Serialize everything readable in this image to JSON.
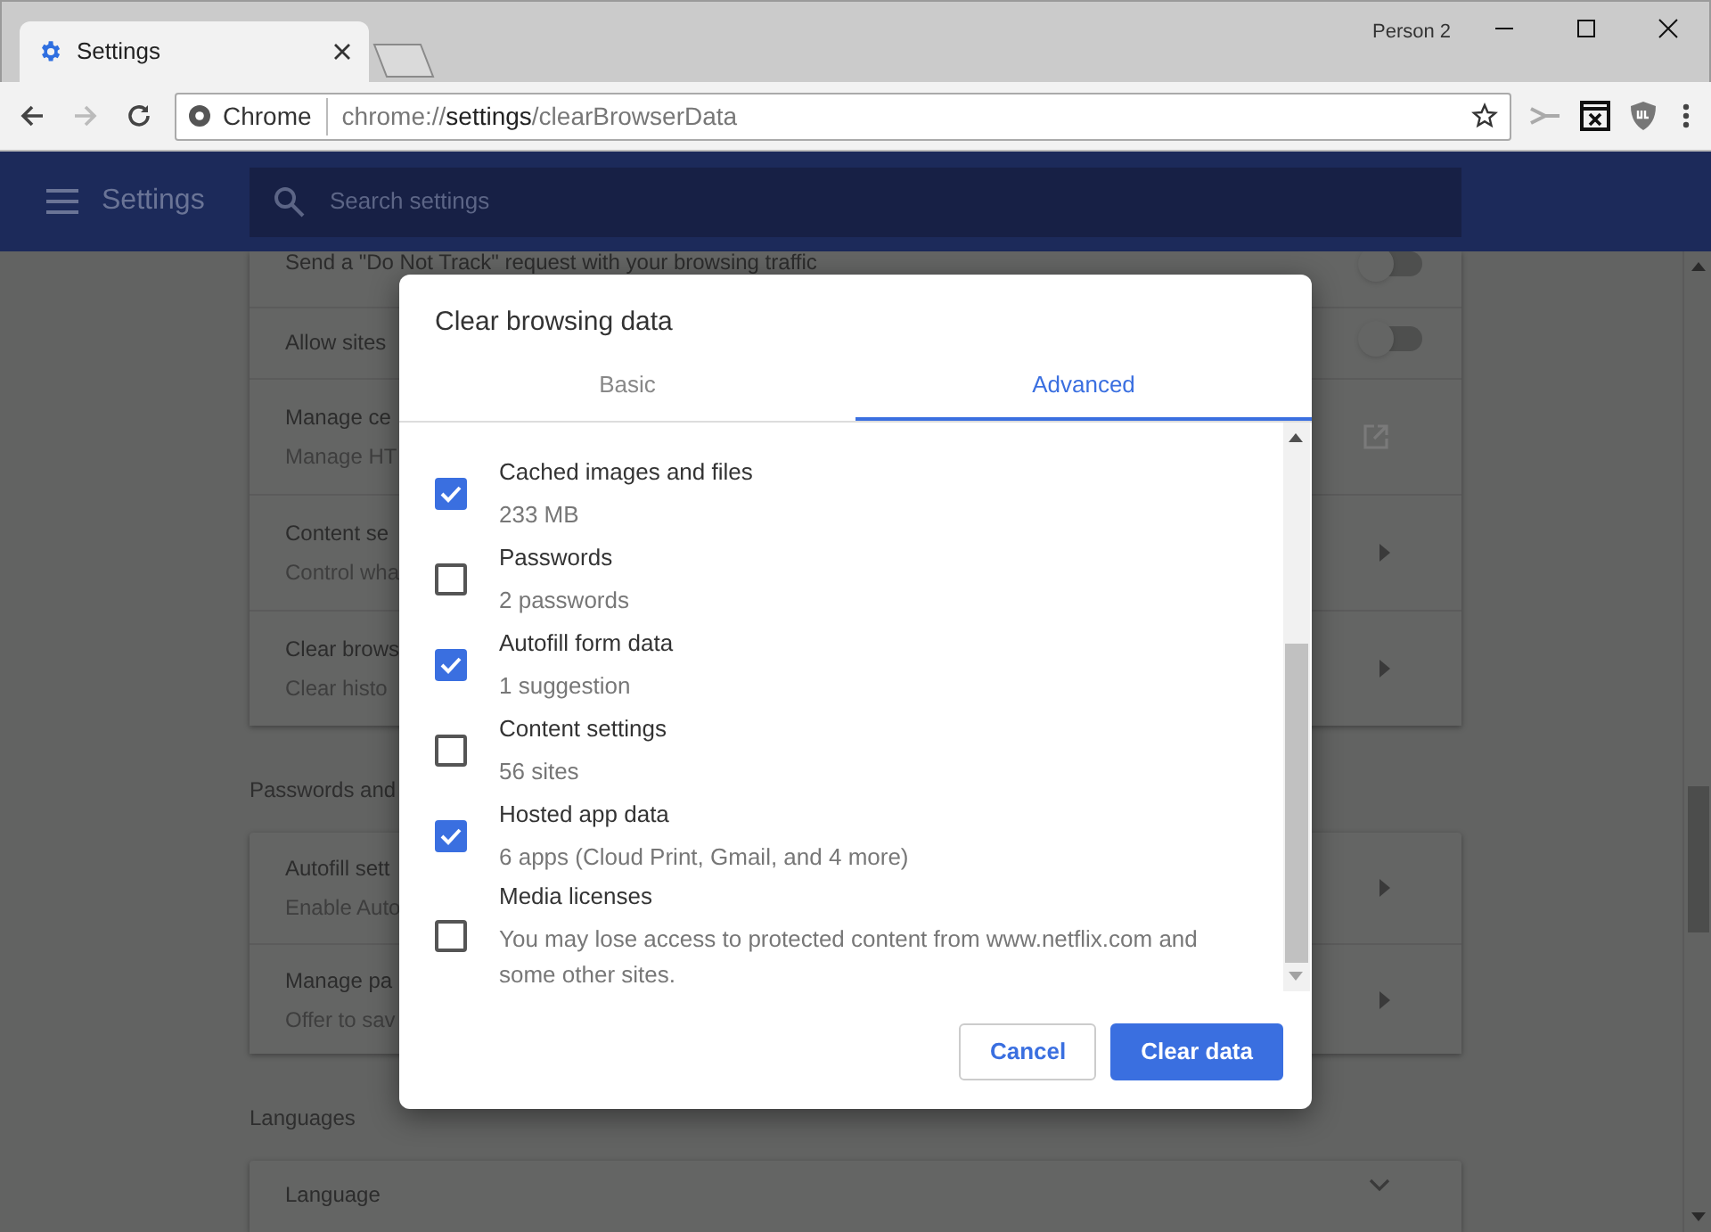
{
  "browser": {
    "tab": {
      "title": "Settings"
    },
    "profile": "Person 2",
    "omnibox": {
      "chip": "Chrome",
      "url_scheme": "chrome://",
      "url_host": "settings",
      "url_path": "/clearBrowserData"
    }
  },
  "header": {
    "title": "Settings",
    "search": {
      "placeholder": "Search settings"
    }
  },
  "sections": [
    {
      "rows": [
        {
          "title": "Send a \"Do Not Track\" request with your browsing traffic",
          "kind": "toggle",
          "on": false
        },
        {
          "title": "Allow sites",
          "kind": "toggle",
          "on": false
        },
        {
          "title": "Manage ce",
          "subtitle": "Manage HT",
          "kind": "external"
        },
        {
          "title": "Content se",
          "subtitle": "Control wha",
          "kind": "arrow"
        },
        {
          "title": "Clear brows",
          "subtitle": "Clear histo",
          "kind": "arrow"
        }
      ]
    },
    {
      "heading": "Passwords and",
      "rows": [
        {
          "title": "Autofill sett",
          "subtitle": "Enable Auto",
          "kind": "arrow"
        },
        {
          "title": "Manage pa",
          "subtitle": "Offer to sav",
          "kind": "arrow"
        }
      ]
    },
    {
      "heading": "Languages",
      "rows": [
        {
          "title": "Language",
          "kind": "chevron"
        }
      ]
    }
  ],
  "dialog": {
    "title": "Clear browsing data",
    "tabs": [
      {
        "label": "Basic",
        "selected": false
      },
      {
        "label": "Advanced",
        "selected": true
      }
    ],
    "items": [
      {
        "label": "Cached images and files",
        "detail": "233 MB",
        "checked": true
      },
      {
        "label": "Passwords",
        "detail": "2 passwords",
        "checked": false
      },
      {
        "label": "Autofill form data",
        "detail": "1 suggestion",
        "checked": true
      },
      {
        "label": "Content settings",
        "detail": "56 sites",
        "checked": false
      },
      {
        "label": "Hosted app data",
        "detail": "6 apps (Cloud Print, Gmail, and 4 more)",
        "checked": true
      },
      {
        "label": "Media licenses",
        "detail": "You may lose access to protected content from www.netflix.com and some other sites.",
        "checked": false
      }
    ],
    "buttons": [
      {
        "label": "Cancel",
        "kind": "secondary"
      },
      {
        "label": "Clear data",
        "kind": "primary"
      }
    ]
  }
}
